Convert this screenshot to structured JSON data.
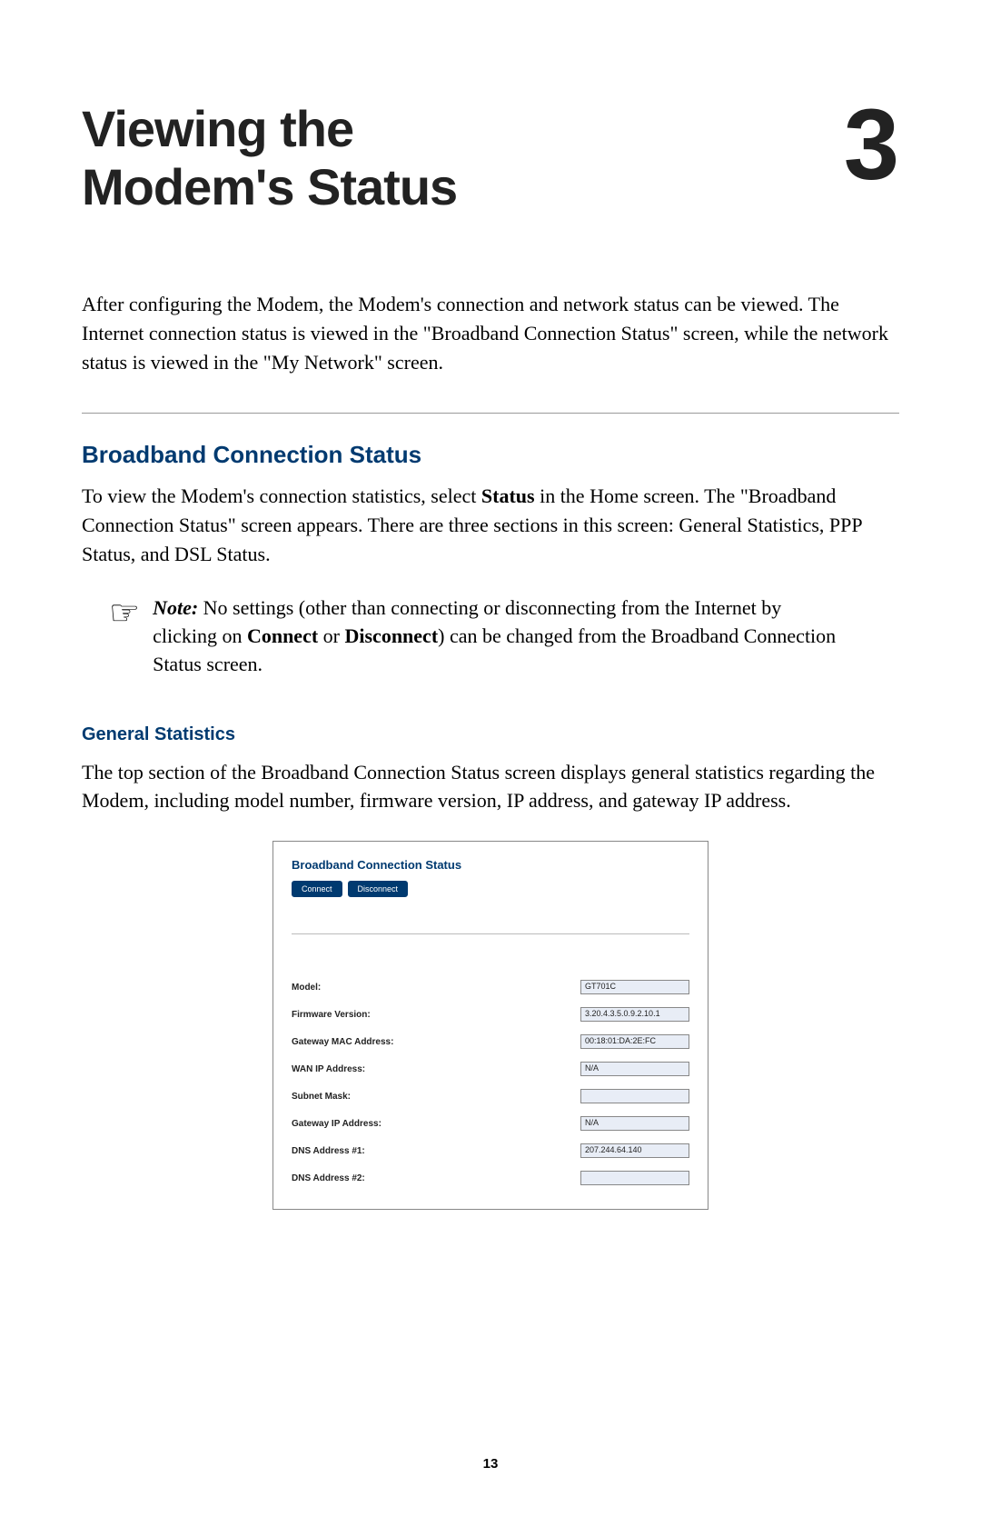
{
  "chapter": {
    "title_line1": "Viewing the",
    "title_line2": "Modem's Status",
    "number": "3"
  },
  "intro": "After configuring the Modem, the Modem's connection and network status can be viewed. The Internet connection status is viewed in the \"Broadband Connection Status\" screen, while the network status is viewed in the \"My Network\" screen.",
  "section": {
    "heading": "Broadband Connection Status",
    "body_pre": "To view the Modem's connection statistics, select ",
    "body_bold": "Status",
    "body_post": " in the Home screen. The \"Broadband Connection Status\" screen appears.  There are three sections in this screen: General Statistics, PPP Status, and DSL Status."
  },
  "note": {
    "label": "Note:",
    "pre": " No settings (other than connecting or disconnecting from the Internet by clicking on ",
    "connect": "Connect",
    "mid": " or ",
    "disconnect": "Disconnect",
    "post": ") can be changed from the Broadband Connection Status screen."
  },
  "subsection": {
    "heading": "General Statistics",
    "body": "The top section of the Broadband Connection Status screen displays general statistics regarding the Modem, including model number, firmware version, IP address, and gateway IP address."
  },
  "screenshot": {
    "title": "Broadband Connection Status",
    "buttons": {
      "connect": "Connect",
      "disconnect": "Disconnect"
    },
    "rows": [
      {
        "label": "Model:",
        "value": "GT701C"
      },
      {
        "label": "Firmware Version:",
        "value": "3.20.4.3.5.0.9.2.10.1"
      },
      {
        "label": "Gateway MAC Address:",
        "value": "00:18:01:DA:2E:FC"
      },
      {
        "label": "WAN IP Address:",
        "value": "N/A"
      },
      {
        "label": "Subnet Mask:",
        "value": ""
      },
      {
        "label": "Gateway IP Address:",
        "value": "N/A"
      },
      {
        "label": "DNS Address #1:",
        "value": "207.244.64.140"
      },
      {
        "label": "DNS Address #2:",
        "value": ""
      }
    ]
  },
  "page_number": "13"
}
